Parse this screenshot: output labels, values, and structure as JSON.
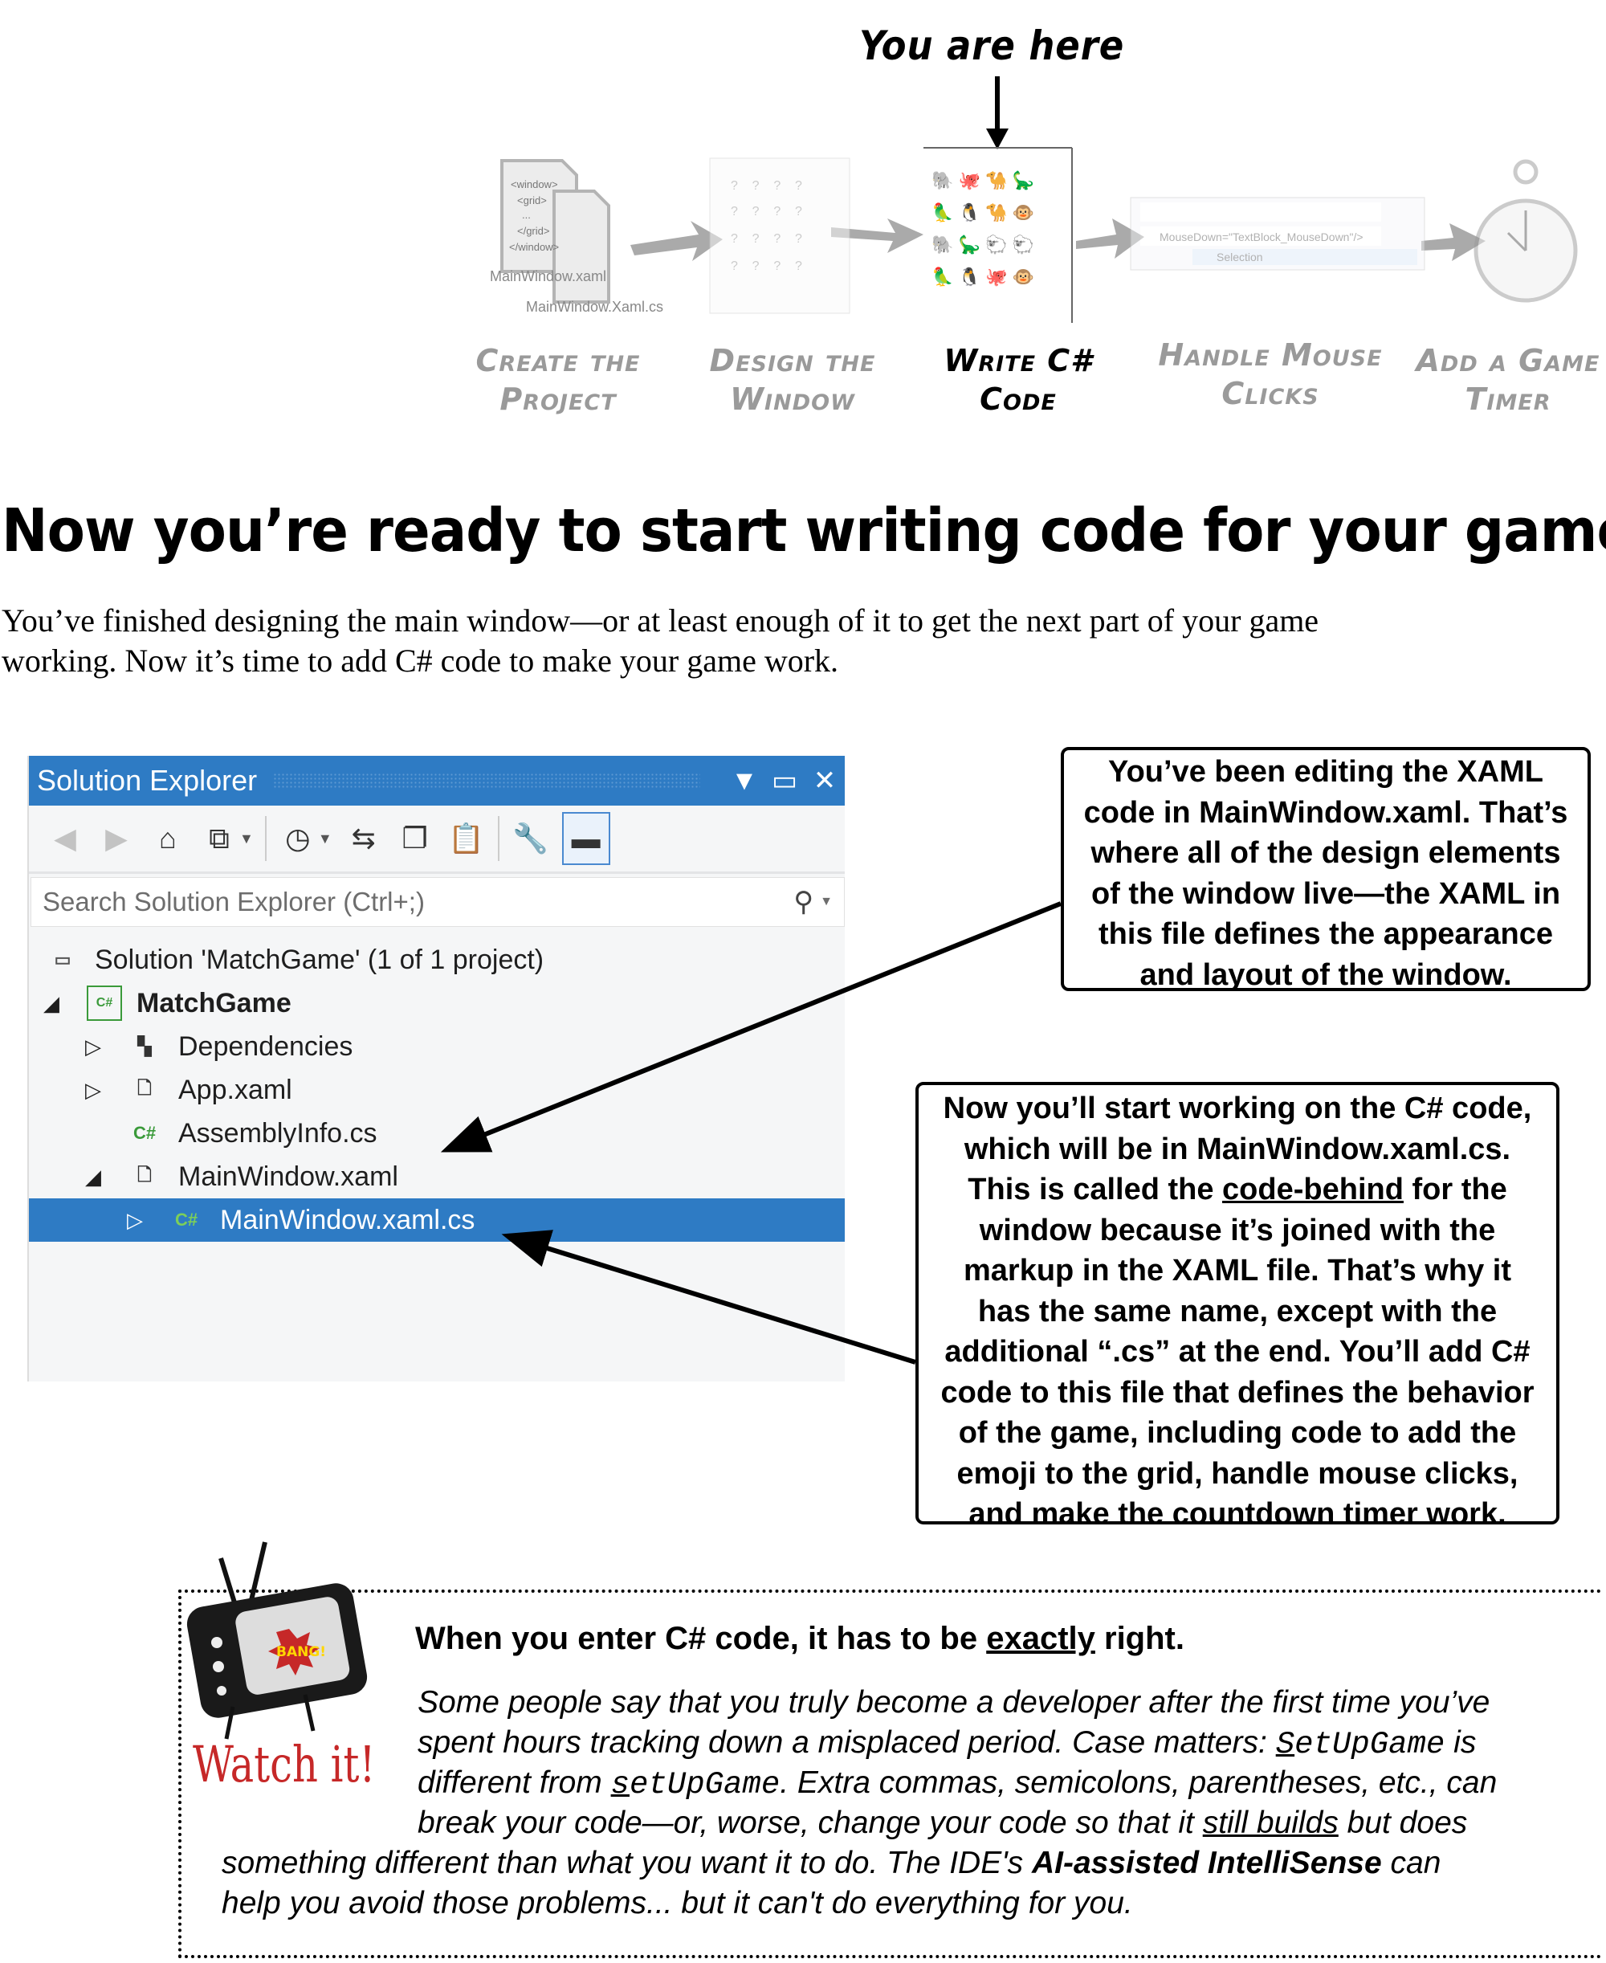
{
  "roadmap": {
    "you_are_here": "You are here",
    "thumb_files": [
      "MainWindow.xaml",
      "MainWindow.Xaml.cs"
    ],
    "thumb_code_lines": [
      "<window>",
      "<grid>",
      "...",
      "</grid>",
      "</window>"
    ],
    "thumb_mouse_text": "MouseDown=\"TextBlock_MouseDown\"/>",
    "thumb_mouse_selection": "Selection",
    "steps": [
      {
        "lines": [
          "Create the",
          "Project"
        ],
        "current": false
      },
      {
        "lines": [
          "Design the",
          "Window"
        ],
        "current": false
      },
      {
        "lines": [
          "Write C#",
          "Code"
        ],
        "current": true
      },
      {
        "lines": [
          "Handle Mouse",
          "Clicks"
        ],
        "current": false
      },
      {
        "lines": [
          "Add a Game",
          "Timer"
        ],
        "current": false
      }
    ]
  },
  "heading": "Now you’re ready to start writing code for your game",
  "intro": "You’ve finished designing the main window—or at least enough of it to get the next part of your game working. Now it’s time to add C# code to make your game work.",
  "solution_explorer": {
    "title": "Solution Explorer",
    "search_placeholder": "Search Solution Explorer (Ctrl+;)",
    "accent": "#2e7bc4",
    "tree": [
      {
        "label": "Solution 'MatchGame' (1 of 1 project)",
        "icon": "solution-icon",
        "expander": "",
        "bold": false,
        "selected": false
      },
      {
        "label": "MatchGame",
        "icon": "csharp-project-icon",
        "expander": "expanded",
        "bold": true,
        "selected": false
      },
      {
        "label": "Dependencies",
        "icon": "dependencies-icon",
        "expander": "collapsed",
        "bold": false,
        "selected": false
      },
      {
        "label": "App.xaml",
        "icon": "xaml-file-icon",
        "expander": "collapsed",
        "bold": false,
        "selected": false
      },
      {
        "label": "AssemblyInfo.cs",
        "icon": "csharp-file-icon",
        "expander": "",
        "bold": false,
        "selected": false
      },
      {
        "label": "MainWindow.xaml",
        "icon": "xaml-file-icon",
        "expander": "expanded",
        "bold": false,
        "selected": false
      },
      {
        "label": "MainWindow.xaml.cs",
        "icon": "csharp-class-icon",
        "expander": "collapsed",
        "bold": false,
        "selected": true
      }
    ]
  },
  "callouts": {
    "xaml": [
      "You’ve been editing the XAML",
      "code in MainWindow.xaml. That’s",
      "where all of the design elements",
      "of the window live—the XAML in",
      "this file defines the appearance",
      "and layout of the window."
    ],
    "cs": [
      [
        {
          "t": "Now you’ll start working on the C# code,"
        }
      ],
      [
        {
          "t": "which will be in MainWindow.xaml.cs."
        }
      ],
      [
        {
          "t": "This is called the "
        },
        {
          "t": "code-behind",
          "u": true
        },
        {
          "t": " for the"
        }
      ],
      [
        {
          "t": "window because it’s joined with the"
        }
      ],
      [
        {
          "t": "markup in the XAML file. That’s why it"
        }
      ],
      [
        {
          "t": "has the same name, except with the"
        }
      ],
      [
        {
          "t": "additional “.cs” at the end. You’ll add C#"
        }
      ],
      [
        {
          "t": "code to this file that defines the behavior"
        }
      ],
      [
        {
          "t": "of the game, including code to add the"
        }
      ],
      [
        {
          "t": "emoji to the grid, handle mouse clicks,"
        }
      ],
      [
        {
          "t": "and make the countdown timer work."
        }
      ]
    ]
  },
  "watch_it": {
    "badge": "Watch it!",
    "bang": "BANG!",
    "title_parts": [
      {
        "t": "When you enter C# code, it has to be "
      },
      {
        "t": "exactly",
        "u": true
      },
      {
        "t": " right."
      }
    ],
    "lines": [
      [
        {
          "t": "Some people say that you truly become a developer after the first time you’ve"
        }
      ],
      [
        {
          "t": "spent hours tracking down a misplaced period. Case matters: "
        },
        {
          "t": "S",
          "u": true,
          "m": true
        },
        {
          "t": "etUpGame",
          "m": true
        },
        {
          "t": " is"
        }
      ],
      [
        {
          "t": "different from "
        },
        {
          "t": "s",
          "u": true,
          "m": true
        },
        {
          "t": "etUpGame",
          "m": true
        },
        {
          "t": ". Extra commas, semicolons, parentheses, etc., can"
        }
      ],
      [
        {
          "t": "break your code—or, worse, change your code so that it "
        },
        {
          "t": "still builds",
          "u": true
        },
        {
          "t": " but does"
        }
      ],
      [
        {
          "t": "something different than what you want it to do. The IDE's "
        },
        {
          "t": "AI-assisted IntelliSense",
          "b": true
        },
        {
          "t": " can"
        }
      ],
      [
        {
          "t": "help you avoid those problems... but it can't do everything for you."
        }
      ]
    ]
  }
}
